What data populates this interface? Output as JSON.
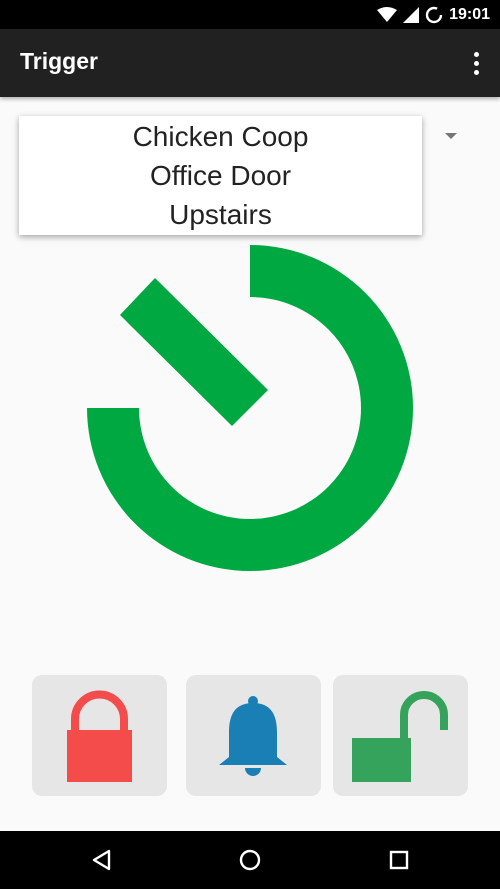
{
  "status_bar": {
    "time": "19:01",
    "icons": [
      "wifi-icon",
      "cell-signal-icon",
      "battery-icon"
    ]
  },
  "app_bar": {
    "title": "Trigger",
    "menu_icon": "overflow-menu-icon"
  },
  "location_dropdown": {
    "options": [
      "Chicken Coop",
      "Office Door",
      "Upstairs"
    ]
  },
  "power_button": {
    "icon": "power-icon",
    "color": "#00a841"
  },
  "actions": [
    {
      "name": "lock",
      "icon": "lock-closed-icon",
      "color": "#f44b4b"
    },
    {
      "name": "bell",
      "icon": "bell-icon",
      "color": "#1a7fb5"
    },
    {
      "name": "unlock",
      "icon": "lock-open-icon",
      "color": "#35a35b"
    }
  ],
  "nav_bar": {
    "icons": [
      "back-icon",
      "home-icon",
      "recents-icon"
    ]
  }
}
